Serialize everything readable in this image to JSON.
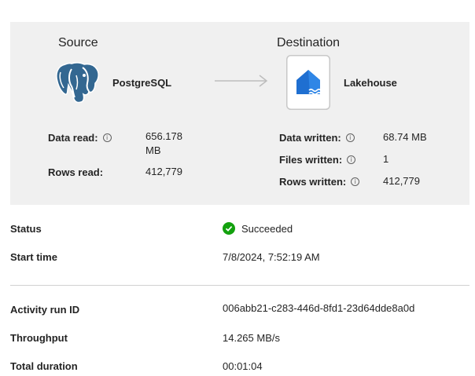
{
  "source": {
    "heading": "Source",
    "name": "PostgreSQL",
    "icon": "postgresql-elephant-icon",
    "metrics": [
      {
        "label": "Data read:",
        "info": true,
        "value_line1": "656.178",
        "value_line2": "MB"
      },
      {
        "label": "Rows read:",
        "info": false,
        "value_line1": "412,779"
      }
    ]
  },
  "destination": {
    "heading": "Destination",
    "name": "Lakehouse",
    "icon": "lakehouse-icon",
    "metrics": [
      {
        "label": "Data written:",
        "value": "68.74 MB"
      },
      {
        "label": "Files written:",
        "value": "1"
      },
      {
        "label": "Rows written:",
        "value": "412,779"
      }
    ]
  },
  "details": {
    "status_label": "Status",
    "status_value": "Succeeded",
    "status_color": "#13a10e",
    "start_time_label": "Start time",
    "start_time_value": "7/8/2024, 7:52:19 AM",
    "activity_run_id_label": "Activity run ID",
    "activity_run_id_value": "006abb21-c283-446d-8fd1-23d64dde8a0d",
    "throughput_label": "Throughput",
    "throughput_value": "14.265 MB/s",
    "total_duration_label": "Total duration",
    "total_duration_value": "00:01:04"
  },
  "info_glyph": "i",
  "colors": {
    "panel_bg": "#f0f0f0",
    "lakehouse_blue": "#1f6fd1",
    "postgres_blue": "#336791"
  }
}
